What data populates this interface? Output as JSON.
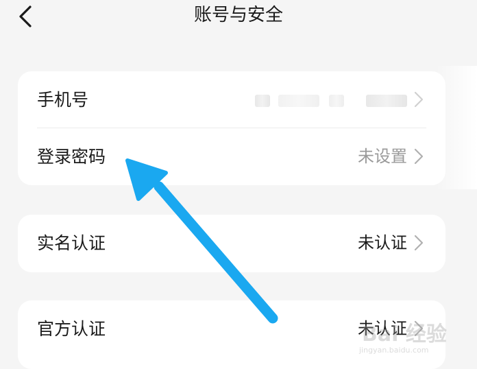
{
  "header": {
    "title": "账号与安全",
    "back_icon": "chevron-left-icon"
  },
  "sections": [
    {
      "rows": [
        {
          "label": "手机号",
          "value": "",
          "value_state": "obscured"
        },
        {
          "label": "登录密码",
          "value": "未设置",
          "value_state": "muted"
        }
      ]
    },
    {
      "rows": [
        {
          "label": "实名认证",
          "value": "未认证",
          "value_state": "dark"
        }
      ]
    },
    {
      "rows": [
        {
          "label": "官方认证",
          "value": "未认证",
          "value_state": "dark"
        }
      ]
    }
  ],
  "annotation": {
    "arrow_color": "#1aa8f0",
    "points_to": "登录密码"
  },
  "watermark": {
    "logo": "Bai 经验",
    "url": "jingyan.baidu.com"
  },
  "colors": {
    "background": "#f5f5f5",
    "card": "#ffffff",
    "muted_text": "#9a9a9a",
    "primary_text": "#1a1a1a",
    "chevron": "#b0b0b0"
  }
}
